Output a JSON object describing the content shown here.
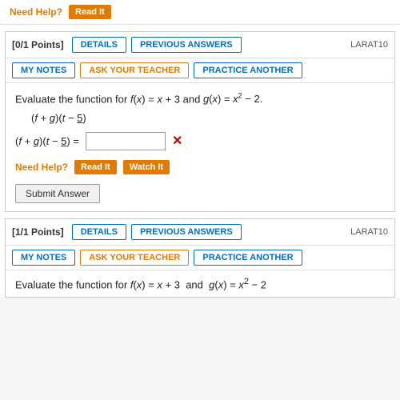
{
  "top_strip": {
    "need_help": "Need Help?",
    "read_it": "Read It"
  },
  "section1": {
    "points": "[0/1 Points]",
    "details": "DETAILS",
    "previous_answers": "PREVIOUS ANSWERS",
    "larat": "LARAT10",
    "my_notes": "MY NOTES",
    "ask_teacher": "ASK YOUR TEACHER",
    "practice_another": "PRACTICE ANOTHER",
    "problem_intro": "Evaluate the function for",
    "fx_expr": "f(x) = x + 3",
    "and_text": "and",
    "gx_expr": "g(x) = x² − 2.",
    "expression": "(f + g)(t − 5)",
    "answer_label": "(f + g)(t − 5) =",
    "answer_value": "",
    "answer_placeholder": "",
    "need_help": "Need Help?",
    "read_it_btn": "Read It",
    "watch_it_btn": "Watch It",
    "submit_btn": "Submit Answer"
  },
  "section2": {
    "points": "[1/1 Points]",
    "details": "DETAILS",
    "previous_answers": "PREVIOUS ANSWERS",
    "larat": "LARAT10",
    "my_notes": "MY NOTES",
    "ask_teacher": "ASK YOUR TEACHER",
    "practice_another": "PRACTICE ANOTHER"
  },
  "bottom": {
    "text": "Evaluate the function for f(x) = x + 3  and  g(x) = x² − 2"
  }
}
